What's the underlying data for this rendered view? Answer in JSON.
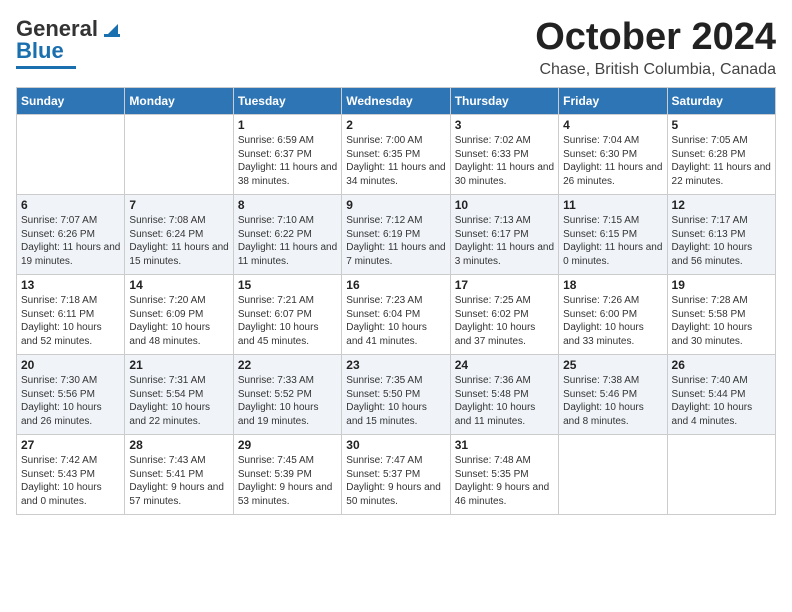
{
  "header": {
    "logo_line1": "General",
    "logo_line2": "Blue",
    "month": "October 2024",
    "location": "Chase, British Columbia, Canada"
  },
  "days_of_week": [
    "Sunday",
    "Monday",
    "Tuesday",
    "Wednesday",
    "Thursday",
    "Friday",
    "Saturday"
  ],
  "weeks": [
    [
      {
        "day": "",
        "info": ""
      },
      {
        "day": "",
        "info": ""
      },
      {
        "day": "1",
        "info": "Sunrise: 6:59 AM\nSunset: 6:37 PM\nDaylight: 11 hours and 38 minutes."
      },
      {
        "day": "2",
        "info": "Sunrise: 7:00 AM\nSunset: 6:35 PM\nDaylight: 11 hours and 34 minutes."
      },
      {
        "day": "3",
        "info": "Sunrise: 7:02 AM\nSunset: 6:33 PM\nDaylight: 11 hours and 30 minutes."
      },
      {
        "day": "4",
        "info": "Sunrise: 7:04 AM\nSunset: 6:30 PM\nDaylight: 11 hours and 26 minutes."
      },
      {
        "day": "5",
        "info": "Sunrise: 7:05 AM\nSunset: 6:28 PM\nDaylight: 11 hours and 22 minutes."
      }
    ],
    [
      {
        "day": "6",
        "info": "Sunrise: 7:07 AM\nSunset: 6:26 PM\nDaylight: 11 hours and 19 minutes."
      },
      {
        "day": "7",
        "info": "Sunrise: 7:08 AM\nSunset: 6:24 PM\nDaylight: 11 hours and 15 minutes."
      },
      {
        "day": "8",
        "info": "Sunrise: 7:10 AM\nSunset: 6:22 PM\nDaylight: 11 hours and 11 minutes."
      },
      {
        "day": "9",
        "info": "Sunrise: 7:12 AM\nSunset: 6:19 PM\nDaylight: 11 hours and 7 minutes."
      },
      {
        "day": "10",
        "info": "Sunrise: 7:13 AM\nSunset: 6:17 PM\nDaylight: 11 hours and 3 minutes."
      },
      {
        "day": "11",
        "info": "Sunrise: 7:15 AM\nSunset: 6:15 PM\nDaylight: 11 hours and 0 minutes."
      },
      {
        "day": "12",
        "info": "Sunrise: 7:17 AM\nSunset: 6:13 PM\nDaylight: 10 hours and 56 minutes."
      }
    ],
    [
      {
        "day": "13",
        "info": "Sunrise: 7:18 AM\nSunset: 6:11 PM\nDaylight: 10 hours and 52 minutes."
      },
      {
        "day": "14",
        "info": "Sunrise: 7:20 AM\nSunset: 6:09 PM\nDaylight: 10 hours and 48 minutes."
      },
      {
        "day": "15",
        "info": "Sunrise: 7:21 AM\nSunset: 6:07 PM\nDaylight: 10 hours and 45 minutes."
      },
      {
        "day": "16",
        "info": "Sunrise: 7:23 AM\nSunset: 6:04 PM\nDaylight: 10 hours and 41 minutes."
      },
      {
        "day": "17",
        "info": "Sunrise: 7:25 AM\nSunset: 6:02 PM\nDaylight: 10 hours and 37 minutes."
      },
      {
        "day": "18",
        "info": "Sunrise: 7:26 AM\nSunset: 6:00 PM\nDaylight: 10 hours and 33 minutes."
      },
      {
        "day": "19",
        "info": "Sunrise: 7:28 AM\nSunset: 5:58 PM\nDaylight: 10 hours and 30 minutes."
      }
    ],
    [
      {
        "day": "20",
        "info": "Sunrise: 7:30 AM\nSunset: 5:56 PM\nDaylight: 10 hours and 26 minutes."
      },
      {
        "day": "21",
        "info": "Sunrise: 7:31 AM\nSunset: 5:54 PM\nDaylight: 10 hours and 22 minutes."
      },
      {
        "day": "22",
        "info": "Sunrise: 7:33 AM\nSunset: 5:52 PM\nDaylight: 10 hours and 19 minutes."
      },
      {
        "day": "23",
        "info": "Sunrise: 7:35 AM\nSunset: 5:50 PM\nDaylight: 10 hours and 15 minutes."
      },
      {
        "day": "24",
        "info": "Sunrise: 7:36 AM\nSunset: 5:48 PM\nDaylight: 10 hours and 11 minutes."
      },
      {
        "day": "25",
        "info": "Sunrise: 7:38 AM\nSunset: 5:46 PM\nDaylight: 10 hours and 8 minutes."
      },
      {
        "day": "26",
        "info": "Sunrise: 7:40 AM\nSunset: 5:44 PM\nDaylight: 10 hours and 4 minutes."
      }
    ],
    [
      {
        "day": "27",
        "info": "Sunrise: 7:42 AM\nSunset: 5:43 PM\nDaylight: 10 hours and 0 minutes."
      },
      {
        "day": "28",
        "info": "Sunrise: 7:43 AM\nSunset: 5:41 PM\nDaylight: 9 hours and 57 minutes."
      },
      {
        "day": "29",
        "info": "Sunrise: 7:45 AM\nSunset: 5:39 PM\nDaylight: 9 hours and 53 minutes."
      },
      {
        "day": "30",
        "info": "Sunrise: 7:47 AM\nSunset: 5:37 PM\nDaylight: 9 hours and 50 minutes."
      },
      {
        "day": "31",
        "info": "Sunrise: 7:48 AM\nSunset: 5:35 PM\nDaylight: 9 hours and 46 minutes."
      },
      {
        "day": "",
        "info": ""
      },
      {
        "day": "",
        "info": ""
      }
    ]
  ]
}
